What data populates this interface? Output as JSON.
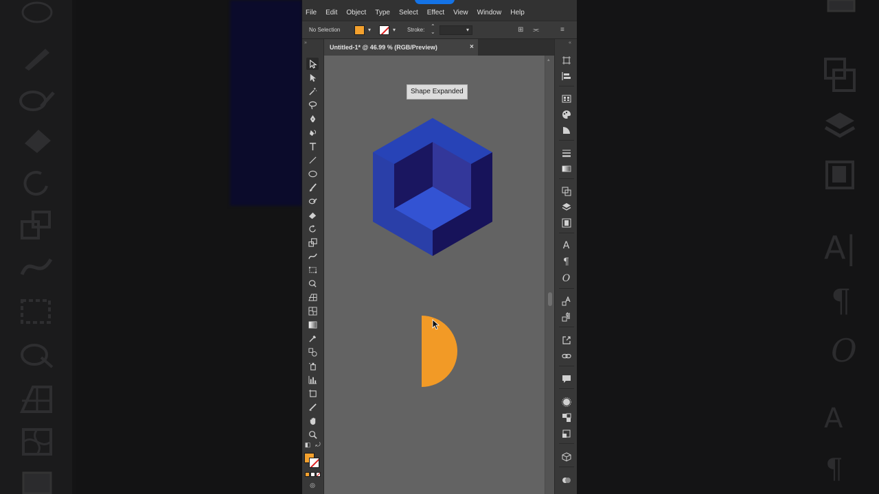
{
  "menu": [
    "File",
    "Edit",
    "Object",
    "Type",
    "Select",
    "Effect",
    "View",
    "Window",
    "Help"
  ],
  "control_bar": {
    "selection_status": "No Selection",
    "stroke_label": "Stroke:",
    "fill_color": "#f4a12e",
    "stroke_color": "none"
  },
  "document": {
    "tab_title": "Untitled-1* @ 46.99 % (RGB/Preview)",
    "close_glyph": "×"
  },
  "canvas": {
    "tooltip": "Shape Expanded",
    "background": "#636363"
  },
  "artwork": {
    "cube_top": "#2743b7",
    "cube_left": "#2a3fa8",
    "cube_right": "#17135a",
    "cube_inner_back": "#1a1660",
    "cube_inner_side": "#33379a",
    "cube_inner_floor": "#3353d3",
    "half_circle": "#f29a26"
  },
  "colors": {
    "app_chrome": "#323232",
    "panel": "#383838",
    "accent": "#1473e6"
  },
  "tools": [
    "selection-tool-icon",
    "direct-selection-tool-icon",
    "magic-wand-icon",
    "lasso-icon",
    "pen-tool-icon",
    "curvature-tool-icon",
    "type-tool-icon",
    "line-tool-icon",
    "ellipse-tool-icon",
    "paintbrush-tool-icon",
    "shaper-tool-icon",
    "eraser-tool-icon",
    "rotate-tool-icon",
    "scale-tool-icon",
    "warp-tool-icon",
    "free-transform-icon",
    "shape-builder-icon",
    "perspective-grid-icon",
    "mesh-tool-icon",
    "gradient-tool-icon",
    "eyedropper-icon",
    "blend-tool-icon",
    "symbol-sprayer-icon",
    "column-graph-icon",
    "artboard-tool-icon",
    "slice-tool-icon",
    "hand-tool-icon",
    "zoom-tool-icon"
  ],
  "dock_panels": [
    "transform-panel-icon",
    "align-panel-icon",
    "swatches-panel-icon",
    "color-guide-icon",
    "color-panel-icon",
    "stroke-panel-icon",
    "gradient-panel-icon",
    "transparency-panel-icon",
    "layers-panel-icon",
    "libraries-panel-icon",
    "character-panel-icon",
    "paragraph-panel-icon",
    "opentype-panel-icon",
    "character-styles-icon",
    "paragraph-styles-icon",
    "export-panel-icon",
    "links-panel-icon",
    "comments-panel-icon",
    "appearance-panel-icon",
    "graphic-styles-icon",
    "symbols-panel-icon",
    "3d-panel-icon",
    "pathfinder-panel-icon"
  ]
}
